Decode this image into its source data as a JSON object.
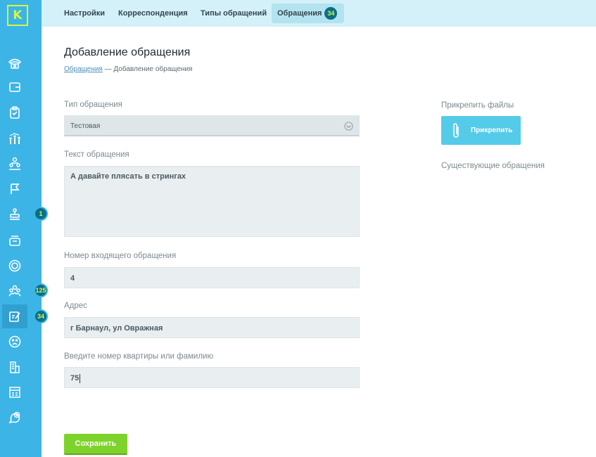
{
  "sidebar": {
    "logo_letter": "K",
    "badges": {
      "b1": "1",
      "b2": "125",
      "b3": "34"
    },
    "items": [
      "phone-icon",
      "wallet-icon",
      "clipboard-icon",
      "chart-people-icon",
      "org-icon",
      "flag-icon",
      "stamp-icon",
      "archive-icon",
      "coin-icon",
      "group-icon",
      "edit-icon",
      "sad-face-icon",
      "buildings-icon",
      "list-icon",
      "chat-plus-icon"
    ]
  },
  "topbar": {
    "tabs": [
      "Настройки",
      "Корреспонденция",
      "Типы обращений",
      "Обращения"
    ],
    "active_badge": "34"
  },
  "page": {
    "title": "Добавление обращения",
    "breadcrumb_link": "Обращения",
    "breadcrumb_sep": "—",
    "breadcrumb_current": "Добавление обращения"
  },
  "form": {
    "type_label": "Тип обращения",
    "type_value": "Тестовая",
    "text_label": "Текст обращения",
    "text_value": "А давайте плясать в стрингах",
    "number_label": "Номер входящего обращения",
    "number_value": "4",
    "address_label": "Адрес",
    "address_value": "г Барнаул, ул Овражная",
    "apartment_label": "Введите номер квартиры или фамилию",
    "apartment_value": "75",
    "save_label": "Сохранить"
  },
  "right": {
    "attach_label": "Прикрепить файлы",
    "attach_button": "Прикрепить",
    "existing_label": "Существующие обращения"
  },
  "colors": {
    "sidebar": "#3cb4e6",
    "accent": "#d6f542",
    "save": "#7ed32b",
    "attach": "#55cbea"
  }
}
